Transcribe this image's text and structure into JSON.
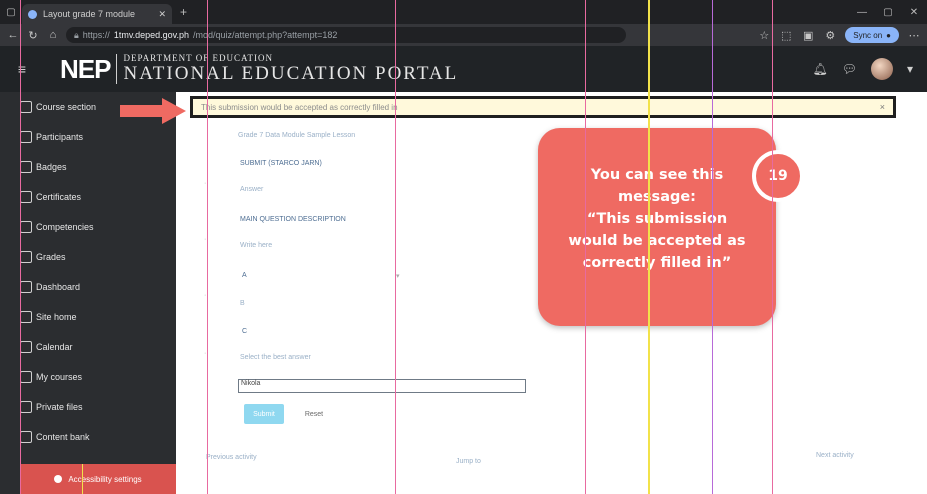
{
  "browser": {
    "tab_title": "Layout grade 7 module",
    "url_prefix": "https://",
    "url_host": "1tmv.deped.gov.ph",
    "url_path": "/mod/quiz/attempt.php?attempt=182",
    "profile_label": "Sync on"
  },
  "site": {
    "logo_mark": "NEP",
    "dept_line": "DEPARTMENT OF EDUCATION",
    "portal_title": "NATIONAL EDUCATION PORTAL"
  },
  "sidebar": {
    "items": [
      {
        "label": "Course section",
        "icon": "list-icon"
      },
      {
        "label": "Participants",
        "icon": "users-icon"
      },
      {
        "label": "Badges",
        "icon": "badge-icon"
      },
      {
        "label": "Certificates",
        "icon": "certificate-icon"
      },
      {
        "label": "Competencies",
        "icon": "star-icon"
      },
      {
        "label": "Grades",
        "icon": "table-icon"
      },
      {
        "label": "Dashboard",
        "icon": "dashboard-icon"
      },
      {
        "label": "Site home",
        "icon": "home-icon"
      },
      {
        "label": "Calendar",
        "icon": "calendar-icon"
      },
      {
        "label": "My courses",
        "icon": "courses-icon"
      },
      {
        "label": "Private files",
        "icon": "file-icon"
      },
      {
        "label": "Content bank",
        "icon": "content-icon"
      }
    ],
    "accessibility_label": "Accessibility settings"
  },
  "notice": {
    "text": "This submission would be accepted as correctly filled in",
    "close": "×"
  },
  "form": {
    "header_line": "Grade 7 Data Module Sample Lesson",
    "field1_label": "SUBMIT (STARCO JARN)",
    "field1_value": "Answer",
    "field2_label": "MAIN QUESTION DESCRIPTION",
    "field2_value": "Write here",
    "field3_value": "A",
    "field4_value": "B",
    "field5_value": "C",
    "field6_label": "Select the best answer",
    "input_value": "Nikola",
    "submit_label": "Submit",
    "reset_label": "Reset",
    "footer_left": "Previous activity",
    "footer_mid": "Jump to",
    "footer_right": "Next activity"
  },
  "callout": {
    "lines": [
      "You can see this",
      "message:",
      "“This submission",
      "would be accepted as",
      "correctly filled in”"
    ],
    "step_number": "19"
  },
  "colors": {
    "callout_bg": "#ef6a62",
    "notice_bg": "#fff9db",
    "sidebar_bg": "#2b2d30",
    "accessibility_bg": "#d9534f",
    "submit_bg": "#8fd8f0"
  }
}
